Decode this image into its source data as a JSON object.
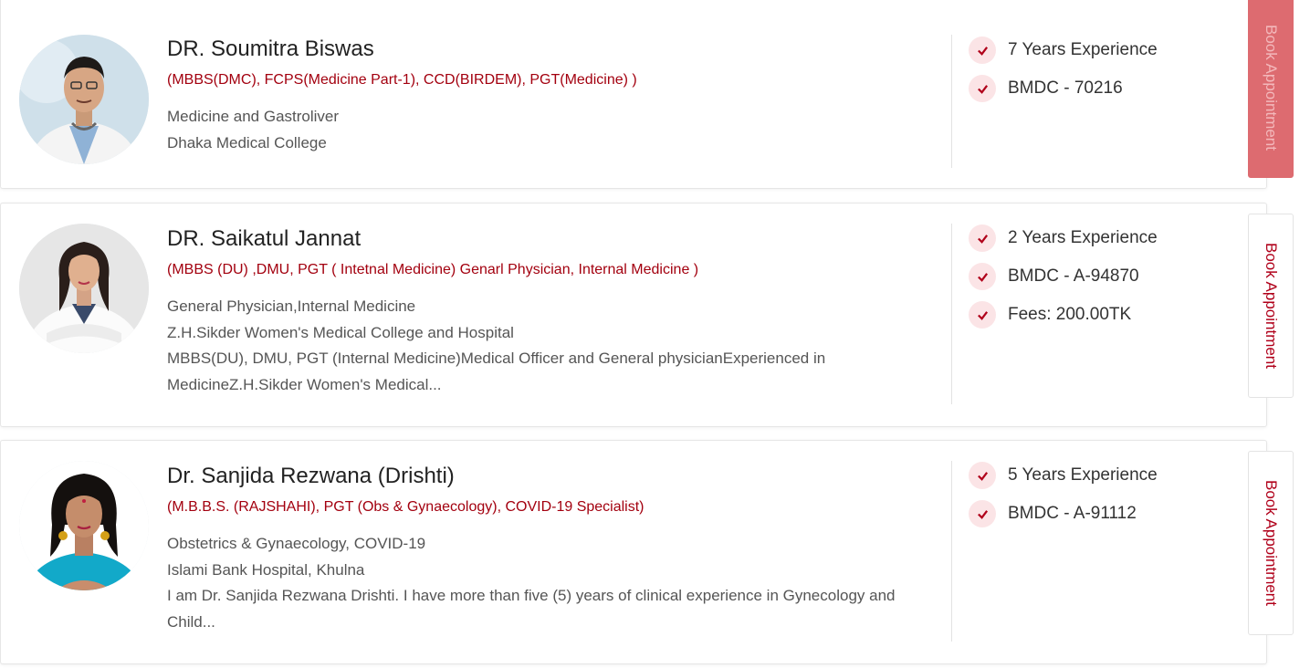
{
  "doctors": [
    {
      "name": "DR. Soumitra Biswas",
      "qualifications": "(MBBS(DMC), FCPS(Medicine Part-1), CCD(BIRDEM), PGT(Medicine) )",
      "specialty": "Medicine and Gastroliver",
      "institution": "Dhaka Medical College",
      "bio": "",
      "stats": [
        "7 Years Experience",
        "BMDC - 70216"
      ],
      "book_label": "Book Appointment"
    },
    {
      "name": "DR. Saikatul Jannat",
      "qualifications": "(MBBS (DU) ,DMU, PGT ( Intetnal Medicine) Genarl Physician, Internal Medicine )",
      "specialty": "General Physician,Internal Medicine",
      "institution": "Z.H.Sikder Women's Medical College and Hospital",
      "bio": "MBBS(DU), DMU, PGT (Internal Medicine)Medical Officer and General physicianExperienced in MedicineZ.H.Sikder Women's Medical...",
      "stats": [
        "2 Years Experience",
        "BMDC - A-94870",
        "Fees: 200.00TK"
      ],
      "book_label": "Book Appointment"
    },
    {
      "name": "Dr. Sanjida Rezwana (Drishti)",
      "qualifications": "(M.B.B.S. (RAJSHAHI), PGT (Obs & Gynaecology), COVID-19 Specialist)",
      "specialty": "Obstetrics & Gynaecology, COVID-19",
      "institution": "Islami Bank Hospital, Khulna",
      "bio": "I am Dr. Sanjida Rezwana Drishti. I have more than five (5) years of clinical experience in Gynecology and Child...",
      "stats": [
        "5 Years Experience",
        "BMDC - A-91112"
      ],
      "book_label": "Book Appointment"
    }
  ],
  "colors": {
    "accent": "#a3000f",
    "check_bg": "#fbe4e6",
    "active_button": "#dd6b70"
  }
}
